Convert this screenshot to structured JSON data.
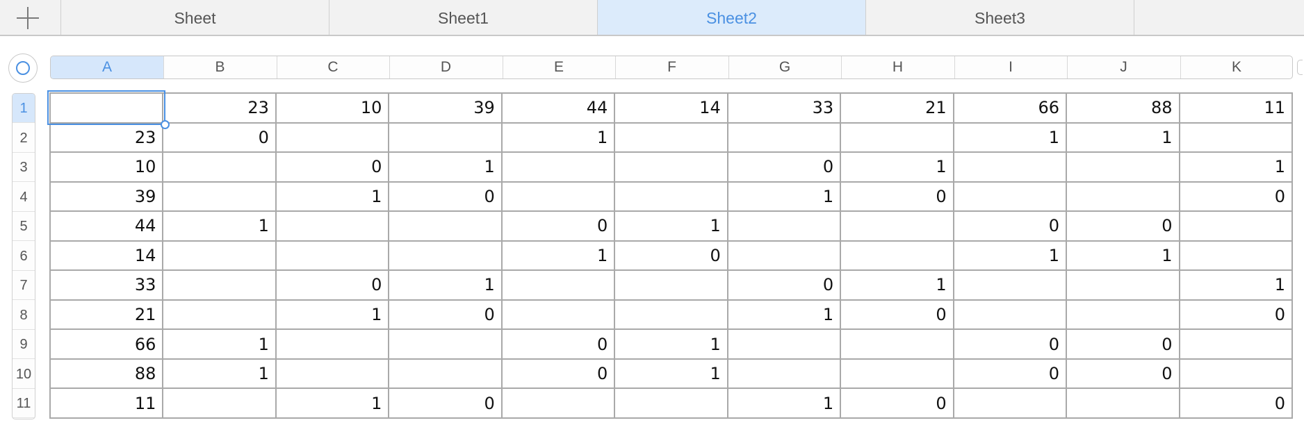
{
  "tabs": [
    {
      "label": "Sheet",
      "active": false
    },
    {
      "label": "Sheet1",
      "active": false
    },
    {
      "label": "Sheet2",
      "active": true
    },
    {
      "label": "Sheet3",
      "active": false
    }
  ],
  "icons": {
    "add_sheet": "plus-icon",
    "select_all": "circle-icon"
  },
  "colors": {
    "accent": "#4a90e2",
    "active_tab_bg": "#dcebfb",
    "grid_line": "#a9a9a9"
  },
  "columns": [
    "A",
    "B",
    "C",
    "D",
    "E",
    "F",
    "G",
    "H",
    "I",
    "J",
    "K"
  ],
  "rows": [
    "1",
    "2",
    "3",
    "4",
    "5",
    "6",
    "7",
    "8",
    "9",
    "10",
    "11"
  ],
  "selection": {
    "column": "A",
    "row": "1"
  },
  "cells": [
    [
      "",
      "23",
      "10",
      "39",
      "44",
      "14",
      "33",
      "21",
      "66",
      "88",
      "11"
    ],
    [
      "23",
      "0",
      "",
      "",
      "1",
      "",
      "",
      "",
      "1",
      "1",
      ""
    ],
    [
      "10",
      "",
      "0",
      "1",
      "",
      "",
      "0",
      "1",
      "",
      "",
      "1"
    ],
    [
      "39",
      "",
      "1",
      "0",
      "",
      "",
      "1",
      "0",
      "",
      "",
      "0"
    ],
    [
      "44",
      "1",
      "",
      "",
      "0",
      "1",
      "",
      "",
      "0",
      "0",
      ""
    ],
    [
      "14",
      "",
      "",
      "",
      "1",
      "0",
      "",
      "",
      "1",
      "1",
      ""
    ],
    [
      "33",
      "",
      "0",
      "1",
      "",
      "",
      "0",
      "1",
      "",
      "",
      "1"
    ],
    [
      "21",
      "",
      "1",
      "0",
      "",
      "",
      "1",
      "0",
      "",
      "",
      "0"
    ],
    [
      "66",
      "1",
      "",
      "",
      "0",
      "1",
      "",
      "",
      "0",
      "0",
      ""
    ],
    [
      "88",
      "1",
      "",
      "",
      "0",
      "1",
      "",
      "",
      "0",
      "0",
      ""
    ],
    [
      "11",
      "",
      "1",
      "0",
      "",
      "",
      "1",
      "0",
      "",
      "",
      "0"
    ]
  ]
}
